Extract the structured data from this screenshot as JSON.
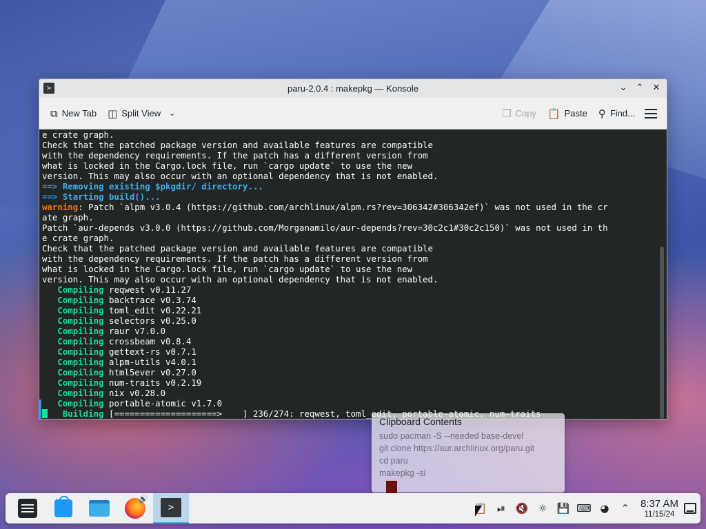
{
  "window": {
    "title": "paru-2.0.4 : makepkg — Konsole"
  },
  "toolbar": {
    "new_tab": "New Tab",
    "split_view": "Split View",
    "copy": "Copy",
    "paste": "Paste",
    "find": "Find..."
  },
  "terminal": {
    "lines": [
      {
        "kind": "plain",
        "text": "e crate graph."
      },
      {
        "kind": "plain",
        "text": "Check that the patched package version and available features are compatible"
      },
      {
        "kind": "plain",
        "text": "with the dependency requirements. If the patch has a different version from"
      },
      {
        "kind": "plain",
        "text": "what is locked in the Cargo.lock file, run `cargo update` to use the new"
      },
      {
        "kind": "plain",
        "text": "version. This may also occur with an optional dependency that is not enabled."
      },
      {
        "kind": "arrow",
        "prefix": "==> ",
        "text": "Removing existing $pkgdir/ directory..."
      },
      {
        "kind": "arrow",
        "prefix": "==> ",
        "text": "Starting build()..."
      },
      {
        "kind": "warning",
        "prefix": "warning",
        "text": ": Patch `alpm v3.0.4 (https://github.com/archlinux/alpm.rs?rev=306342#306342ef)` was not used in the cr"
      },
      {
        "kind": "plain",
        "text": "ate graph."
      },
      {
        "kind": "plain",
        "text": "Patch `aur-depends v3.0.0 (https://github.com/Morganamilo/aur-depends?rev=30c2c1#30c2c150)` was not used in th"
      },
      {
        "kind": "plain",
        "text": "e crate graph."
      },
      {
        "kind": "plain",
        "text": "Check that the patched package version and available features are compatible"
      },
      {
        "kind": "plain",
        "text": "with the dependency requirements. If the patch has a different version from"
      },
      {
        "kind": "plain",
        "text": "what is locked in the Cargo.lock file, run `cargo update` to use the new"
      },
      {
        "kind": "plain",
        "text": "version. This may also occur with an optional dependency that is not enabled."
      },
      {
        "kind": "compile",
        "prefix": "   Compiling",
        "text": " reqwest v0.11.27"
      },
      {
        "kind": "compile",
        "prefix": "   Compiling",
        "text": " backtrace v0.3.74"
      },
      {
        "kind": "compile",
        "prefix": "   Compiling",
        "text": " toml_edit v0.22.21"
      },
      {
        "kind": "compile",
        "prefix": "   Compiling",
        "text": " selectors v0.25.0"
      },
      {
        "kind": "compile",
        "prefix": "   Compiling",
        "text": " raur v7.0.0"
      },
      {
        "kind": "compile",
        "prefix": "   Compiling",
        "text": " crossbeam v0.8.4"
      },
      {
        "kind": "compile",
        "prefix": "   Compiling",
        "text": " gettext-rs v0.7.1"
      },
      {
        "kind": "compile",
        "prefix": "   Compiling",
        "text": " alpm-utils v4.0.1"
      },
      {
        "kind": "compile",
        "prefix": "   Compiling",
        "text": " html5ever v0.27.0"
      },
      {
        "kind": "compile",
        "prefix": "   Compiling",
        "text": " num-traits v0.2.19"
      },
      {
        "kind": "compile",
        "prefix": "   Compiling",
        "text": " nix v0.28.0"
      },
      {
        "kind": "compile",
        "prefix": "   Compiling",
        "text": " portable-atomic v1.7.0"
      },
      {
        "kind": "building",
        "prefix": "    Building",
        "text": " [====================>    ] 236/274: reqwest, toml_edit, portable-atomic, num-traits"
      }
    ]
  },
  "clipboard": {
    "title": "Clipboard Contents",
    "items": [
      "sudo pacman -S --needed base-devel",
      "git clone https://aur.archlinux.org/paru.git",
      "cd paru",
      "makepkg -si"
    ]
  },
  "taskbar": {
    "apps": [
      {
        "name": "application-launcher",
        "icon": "launcher-icon"
      },
      {
        "name": "discover",
        "icon": "store-icon"
      },
      {
        "name": "dolphin",
        "icon": "folder-icon"
      },
      {
        "name": "firefox",
        "icon": "firefox-icon"
      },
      {
        "name": "konsole",
        "icon": "terminal-icon"
      }
    ],
    "tray_icons": [
      "clipboard-icon",
      "media-player-icon",
      "volume-muted-icon",
      "brightness-icon",
      "disks-icon",
      "keyboard-layout-icon",
      "update-icon",
      "tray-expand-icon"
    ],
    "clock_time": "8:37 AM",
    "clock_date": "11/15/24"
  },
  "colors": {
    "terminal_bg": "#232627",
    "terminal_fg": "#fcfcfc",
    "arrow_blue": "#1d99f3",
    "warning_orange": "#f67400",
    "compile_green": "#1cdc9a",
    "panel_bg": "#eff0f1"
  }
}
